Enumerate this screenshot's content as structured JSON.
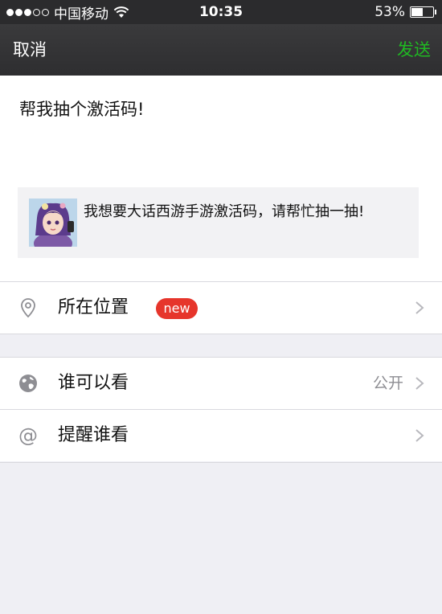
{
  "status_bar": {
    "carrier": "中国移动",
    "time": "10:35",
    "battery_percent": "53%",
    "battery_level": 0.53,
    "signal_full_dots": 3,
    "signal_total_dots": 5
  },
  "nav": {
    "cancel_label": "取消",
    "send_label": "发送"
  },
  "composer": {
    "text": "帮我抽个激活码!",
    "share_card": {
      "text": "我想要大话西游手游激活码，请帮忙抽一抽!"
    }
  },
  "rows": {
    "location": {
      "label": "所在位置",
      "badge": "new"
    },
    "visibility": {
      "label": "谁可以看",
      "value": "公开"
    },
    "remind": {
      "label": "提醒谁看"
    }
  },
  "colors": {
    "send_accent": "#1fb922",
    "badge": "#e6352b",
    "nav_background": "#2e2e30",
    "page_background": "#efeff4"
  },
  "icons": {
    "location": "location-pin-icon",
    "visibility": "globe-icon",
    "remind": "at-sign-icon",
    "chevron": "chevron-right-icon"
  }
}
